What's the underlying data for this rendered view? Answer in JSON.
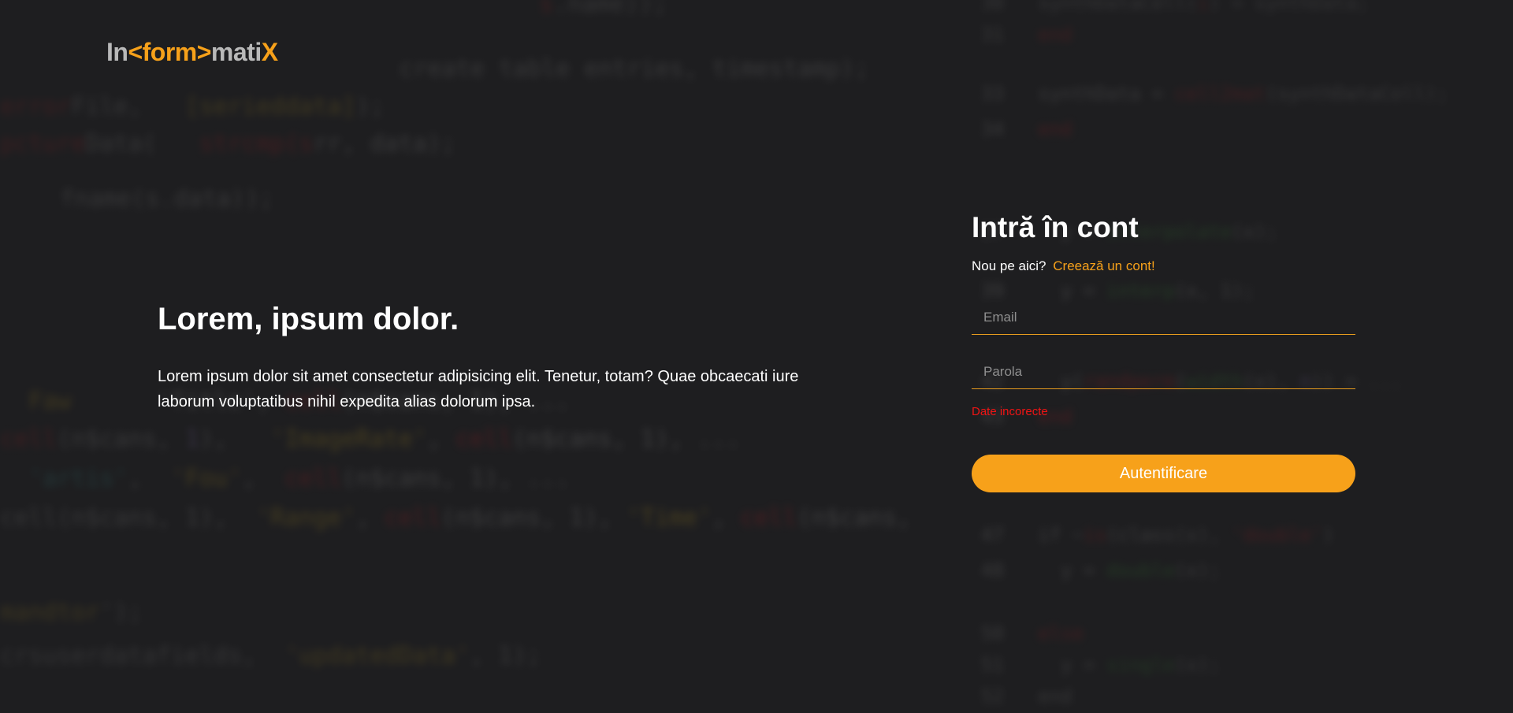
{
  "logo": {
    "part1": "In",
    "part2": "<form>",
    "part3": "mati",
    "part4": "X"
  },
  "hero": {
    "title": "Lorem, ipsum dolor.",
    "text": "Lorem ipsum dolor sit amet consectetur adipisicing elit. Tenetur, totam? Quae obcaecati iure laborum voluptatibus nihil expedita alias dolorum ipsa."
  },
  "login": {
    "title": "Intră în cont",
    "signup_prompt": "Nou pe aici?",
    "signup_link": "Creează un cont!",
    "email_placeholder": "Email",
    "password_placeholder": "Parola",
    "error": "Date incorecte",
    "submit_label": "Autentificare"
  },
  "colors": {
    "accent": "#f7a11a",
    "error": "#f01414",
    "background": "#1e1e20"
  }
}
